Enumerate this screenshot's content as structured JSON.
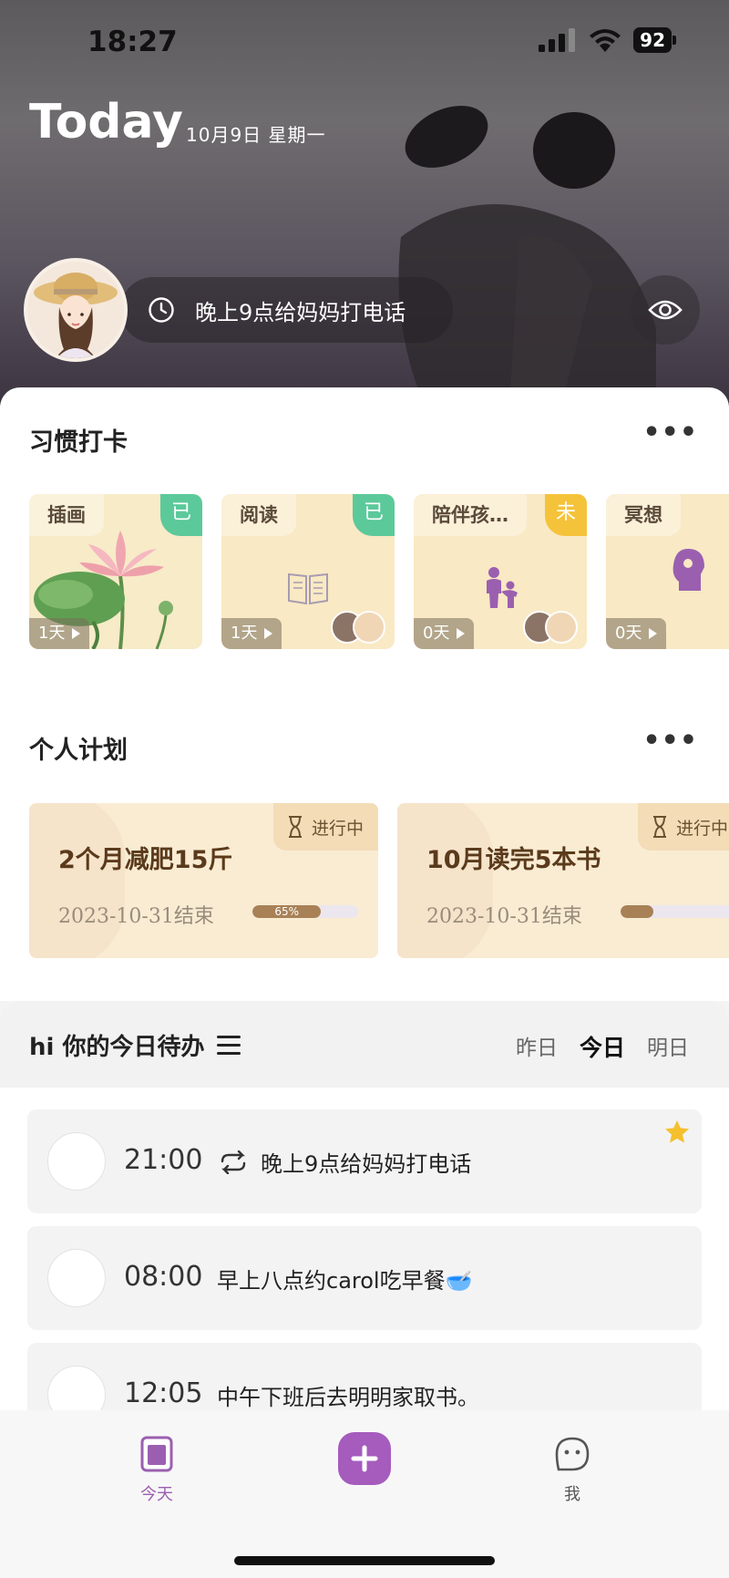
{
  "status_bar": {
    "time": "18:27",
    "battery": "92"
  },
  "hero": {
    "title": "Today",
    "date": "10月9日 星期一",
    "reminder": "晚上9点给妈妈打电话"
  },
  "habits": {
    "title": "习惯打卡",
    "more": "•••",
    "items": [
      {
        "label": "插画",
        "tag": "已",
        "days": "1天"
      },
      {
        "label": "阅读",
        "tag": "已",
        "days": "1天"
      },
      {
        "label": "陪伴孩…",
        "tag": "未",
        "days": "0天"
      },
      {
        "label": "冥想",
        "tag": "",
        "days": "0天"
      }
    ]
  },
  "plans": {
    "title": "个人计划",
    "more": "•••",
    "items": [
      {
        "status": "进行中",
        "title": "2个月减肥15斤",
        "end": "2023-10-31结束",
        "progress_label": "65%",
        "progress": 0.65
      },
      {
        "status": "进行中",
        "title": "10月读完5本书",
        "end": "2023-10-31结束",
        "progress_label": "",
        "progress": 0.26
      }
    ]
  },
  "todo": {
    "title": "hi 你的今日待办",
    "tabs": [
      "昨日",
      "今日",
      "明日"
    ],
    "active_tab": "今日",
    "items": [
      {
        "time": "21:00",
        "text": "晚上9点给妈妈打电话",
        "repeat": true,
        "starred": true
      },
      {
        "time": "08:00",
        "text": "早上八点约carol吃早餐🥣",
        "repeat": false,
        "starred": false
      },
      {
        "time": "12:05",
        "text": "中午下班后去明明家取书。",
        "repeat": false,
        "starred": false
      }
    ]
  },
  "tab_bar": {
    "today": "今天",
    "me": "我"
  },
  "colors": {
    "accent": "#a55cbd",
    "done": "#5cc99a",
    "todo": "#f5c33a",
    "progress": "#a88157"
  }
}
